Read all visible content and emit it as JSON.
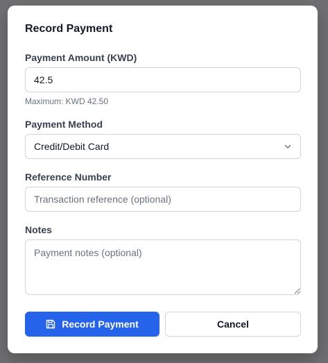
{
  "dialog": {
    "title": "Record Payment",
    "amount": {
      "label": "Payment Amount (KWD)",
      "value": "42.5",
      "hint": "Maximum: KWD 42.50"
    },
    "method": {
      "label": "Payment Method",
      "selected": "Credit/Debit Card"
    },
    "reference": {
      "label": "Reference Number",
      "placeholder": "Transaction reference (optional)"
    },
    "notes": {
      "label": "Notes",
      "placeholder": "Payment notes (optional)"
    },
    "buttons": {
      "submit": "Record Payment",
      "cancel": "Cancel"
    }
  },
  "icons": {
    "submit": "save-icon",
    "dropdown": "chevron-down-icon"
  },
  "colors": {
    "primary": "#2563eb",
    "border": "#d1d5db",
    "text": "#111827",
    "muted": "#6b7280",
    "overlay": "#707073"
  }
}
